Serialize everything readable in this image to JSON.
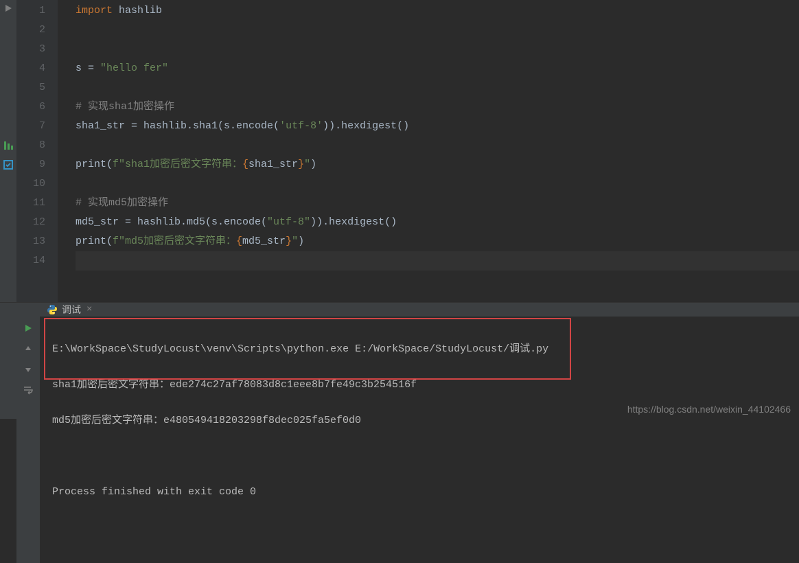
{
  "editor": {
    "line_numbers": [
      "1",
      "2",
      "3",
      "4",
      "5",
      "6",
      "7",
      "8",
      "9",
      "10",
      "11",
      "12",
      "13",
      "14"
    ],
    "code": {
      "l1_kw": "import",
      "l1_mod": " hashlib",
      "l4_a": "s = ",
      "l4_str": "\"hello fer\"",
      "l6_cmt": "# 实现sha1加密操作",
      "l7_a": "sha1_str = hashlib.sha1(s.encode(",
      "l7_str": "'utf-8'",
      "l7_b": ")).hexdigest()",
      "l9_a": "print(",
      "l9_f": "f\"sha1加密后密文字符串：",
      "l9_br1": "{",
      "l9_var": "sha1_str",
      "l9_br2": "}",
      "l9_end": "\"",
      "l9_close": ")",
      "l11_cmt": "# 实现md5加密操作",
      "l12_a": "md5_str = hashlib.md5(s.encode(",
      "l12_str": "\"utf-8\"",
      "l12_b": ")).hexdigest()",
      "l13_a": "print(",
      "l13_f": "f\"md5加密后密文字符串：",
      "l13_br1": "{",
      "l13_var": "md5_str",
      "l13_br2": "}",
      "l13_end": "\"",
      "l13_close": ")"
    }
  },
  "debug_tab": {
    "label": "调试"
  },
  "console": {
    "line1": "E:\\WorkSpace\\StudyLocust\\venv\\Scripts\\python.exe E:/WorkSpace/StudyLocust/调试.py",
    "line2": "sha1加密后密文字符串：ede274c27af78083d8c1eee8b7fe49c3b254516f",
    "line3": "md5加密后密文字符串：e480549418203298f8dec025fa5ef0d0",
    "line5": "Process finished with exit code 0"
  },
  "watermark": "https://blog.csdn.net/weixin_44102466"
}
